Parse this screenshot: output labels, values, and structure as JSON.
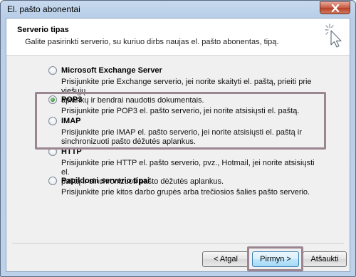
{
  "window": {
    "title": "El. pašto abonentai"
  },
  "header": {
    "title": "Serverio tipas",
    "subtitle": "Galite pasirinkti serverio, su kuriuo dirbs naujas el. pašto abonentas, tipą."
  },
  "options": [
    {
      "label": "Microsoft Exchange Server",
      "desc_line1": "Prisijunkite prie Exchange serverio, jei norite skaityti el. paštą, prieiti prie viešųjų",
      "desc_line2": "aplankų ir bendrai naudotis dokumentais.",
      "selected": false
    },
    {
      "label": "POP3",
      "desc_line1": "Prisijunkite prie POP3 el. pašto serverio, jei norite atsisiųsti el. paštą.",
      "desc_line2": "",
      "selected": true
    },
    {
      "label": "IMAP",
      "desc_line1": "Prisijunkite prie IMAP el. pašto serverio, jei norite atsisiųsti el. paštą ir",
      "desc_line2": "sinchronizuoti pašto dėžutės aplankus.",
      "selected": false
    },
    {
      "label": "HTTP",
      "desc_line1": "Prisijunkite prie HTTP el. pašto serverio, pvz., Hotmail, jei norite atsisiųsti el.",
      "desc_line2": "paštą ir sinchronizuoti pašto dėžutės aplankus.",
      "selected": false
    },
    {
      "label": "Papildomi serverio tipai",
      "desc_line1": "Prisijunkite prie kitos darbo grupės arba trečiosios šalies pašto serverio.",
      "desc_line2": "",
      "selected": false
    }
  ],
  "buttons": {
    "back": "< Atgal",
    "next": "Pirmyn >",
    "cancel": "Atšaukti"
  },
  "icons": {
    "close": "close-icon",
    "wizard": "cursor-sparkle-icon"
  }
}
